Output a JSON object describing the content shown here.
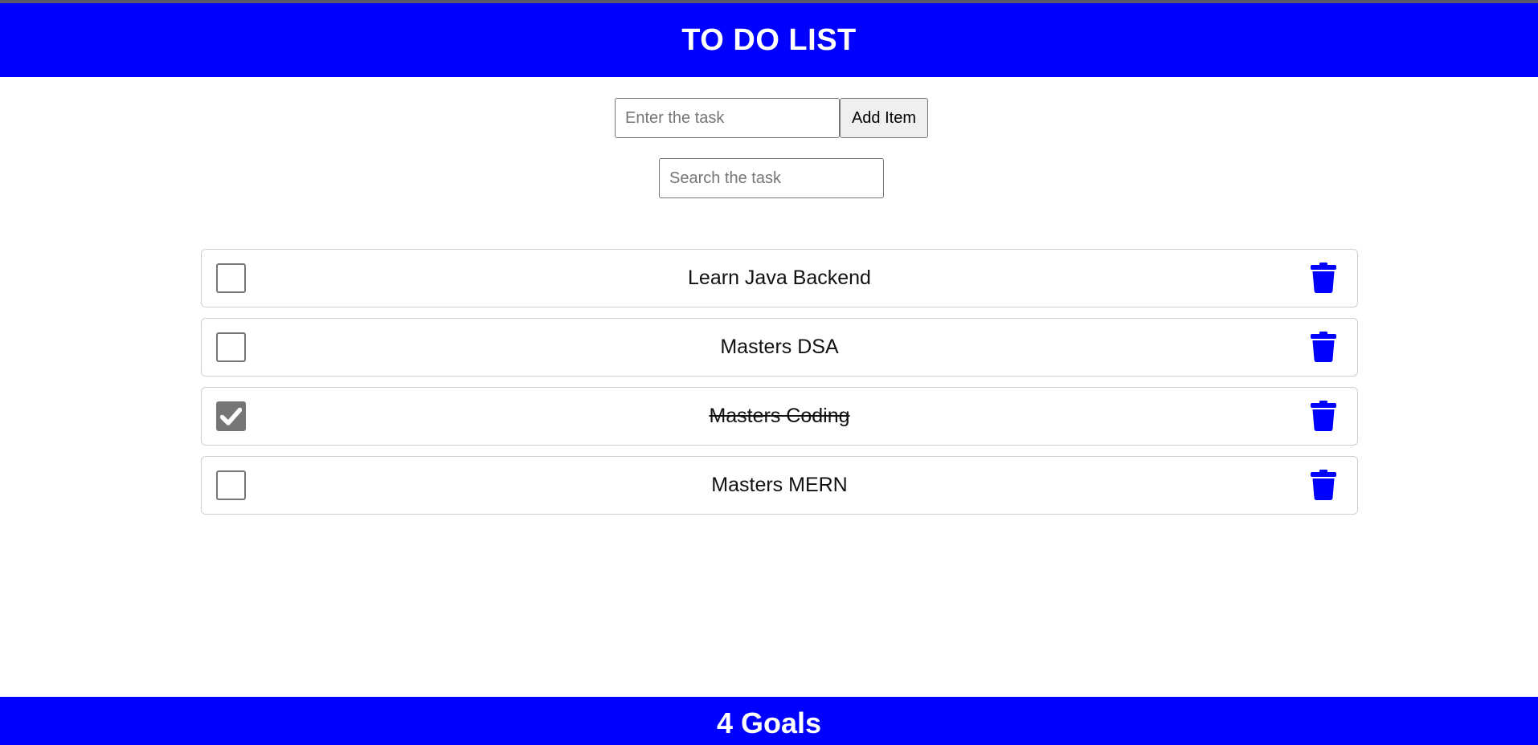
{
  "header": {
    "title": "TO DO LIST"
  },
  "add_form": {
    "placeholder": "Enter the task",
    "value": "",
    "button_label": "Add Item"
  },
  "search": {
    "placeholder": "Search the task",
    "value": ""
  },
  "tasks": [
    {
      "label": "Learn Java Backend",
      "done": false
    },
    {
      "label": "Masters DSA",
      "done": false
    },
    {
      "label": "Masters Coding",
      "done": true
    },
    {
      "label": "Masters MERN",
      "done": false
    }
  ],
  "footer": {
    "summary": "4 Goals"
  },
  "colors": {
    "brand": "#0000ff",
    "checked": "#767676",
    "trash": "#0000ff"
  },
  "icons": {
    "delete": "trash-icon",
    "check": "checkmark-icon"
  }
}
